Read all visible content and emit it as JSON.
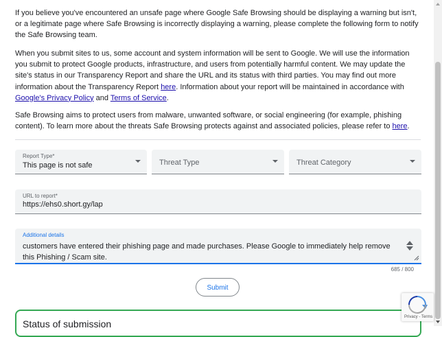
{
  "intro": {
    "p1": "If you believe you've encountered an unsafe page where Google Safe Browsing should be displaying a warning but isn't, or a legitimate page where Safe Browsing is incorrectly displaying a warning, please complete the following form to notify the Safe Browsing team.",
    "p2_a": "When you submit sites to us, some account and system information will be sent to Google. We will use the information you submit to protect Google products, infrastructure, and users from potentially harmful content. We may update the site's status in our Transparency Report and share the URL and its status with third parties. You may find out more information about the Transparency Report ",
    "p2_link1": "here",
    "p2_b": ". Information about your report will be maintained in accordance with ",
    "p2_link2": "Google's Privacy Policy",
    "p2_c": " and ",
    "p2_link3": "Terms of Service",
    "p2_d": ".",
    "p3_a": "Safe Browsing aims to protect users from malware, unwanted software, or social engineering (for example, phishing content). To learn more about the threats Safe Browsing protects against and associated policies, please refer to ",
    "p3_link": "here",
    "p3_b": "."
  },
  "form": {
    "report_type": {
      "label": "Report Type*",
      "value": "This page is not safe"
    },
    "threat_type": {
      "placeholder": "Threat Type"
    },
    "threat_category": {
      "placeholder": "Threat Category"
    },
    "url": {
      "label": "URL to report*",
      "value": "https://ehs0.short.gy/lap"
    },
    "details": {
      "label": "Additional details",
      "value": "customers have entered their phishing page and made purchases. Please Google to immediately help remove this Phishing / Scam site.",
      "counter": "685 / 800"
    },
    "submit_label": "Submit"
  },
  "status": {
    "title": "Status of submission"
  },
  "recaptcha": {
    "links": "Privacy - Terms"
  },
  "colors": {
    "accent": "#1a73e8",
    "link": "#1a0dab",
    "status_border": "#34a853"
  }
}
